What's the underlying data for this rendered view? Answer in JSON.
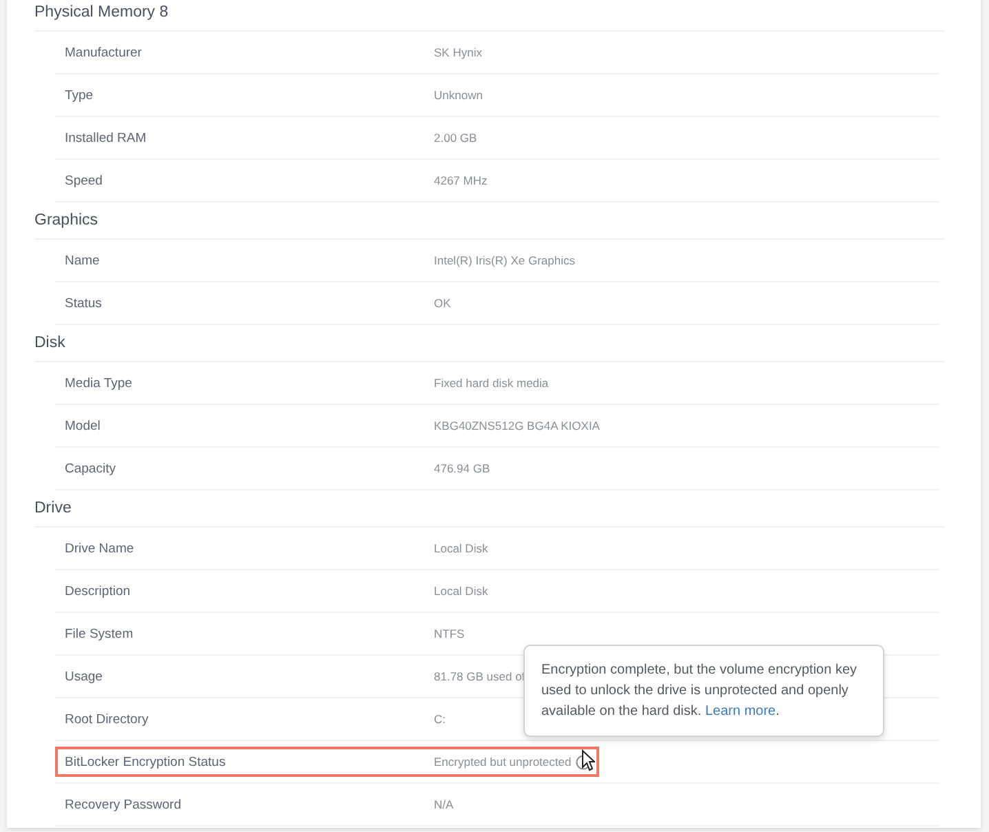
{
  "sections": [
    {
      "title": "Physical Memory 8",
      "rows": [
        {
          "label": "Manufacturer",
          "value": "SK Hynix",
          "highlighted": false,
          "info": false
        },
        {
          "label": "Type",
          "value": "Unknown",
          "highlighted": false,
          "info": false
        },
        {
          "label": "Installed RAM",
          "value": "2.00 GB",
          "highlighted": false,
          "info": false
        },
        {
          "label": "Speed",
          "value": "4267 MHz",
          "highlighted": false,
          "info": false
        }
      ]
    },
    {
      "title": "Graphics",
      "rows": [
        {
          "label": "Name",
          "value": "Intel(R) Iris(R) Xe Graphics",
          "highlighted": false,
          "info": false
        },
        {
          "label": "Status",
          "value": "OK",
          "highlighted": false,
          "info": false
        }
      ]
    },
    {
      "title": "Disk",
      "rows": [
        {
          "label": "Media Type",
          "value": "Fixed hard disk media",
          "highlighted": false,
          "info": false
        },
        {
          "label": "Model",
          "value": "KBG40ZNS512G BG4A KIOXIA",
          "highlighted": false,
          "info": false
        },
        {
          "label": "Capacity",
          "value": "476.94 GB",
          "highlighted": false,
          "info": false
        }
      ]
    },
    {
      "title": "Drive",
      "rows": [
        {
          "label": "Drive Name",
          "value": "Local Disk",
          "highlighted": false,
          "info": false
        },
        {
          "label": "Description",
          "value": "Local Disk",
          "highlighted": false,
          "info": false
        },
        {
          "label": "File System",
          "value": "NTFS",
          "highlighted": false,
          "info": false
        },
        {
          "label": "Usage",
          "value": "81.78 GB used of",
          "highlighted": false,
          "info": false
        },
        {
          "label": "Root Directory",
          "value": "C:",
          "highlighted": false,
          "info": false
        },
        {
          "label": "BitLocker Encryption Status",
          "value": "Encrypted but unprotected",
          "highlighted": true,
          "info": true
        },
        {
          "label": "Recovery Password",
          "value": "N/A",
          "highlighted": false,
          "info": false
        }
      ]
    }
  ],
  "tooltip": {
    "text": "Encryption complete, but the volume encryption key used to unlock the drive is unprotected and openly available on the hard disk.",
    "link": "Learn more",
    "after": "."
  }
}
